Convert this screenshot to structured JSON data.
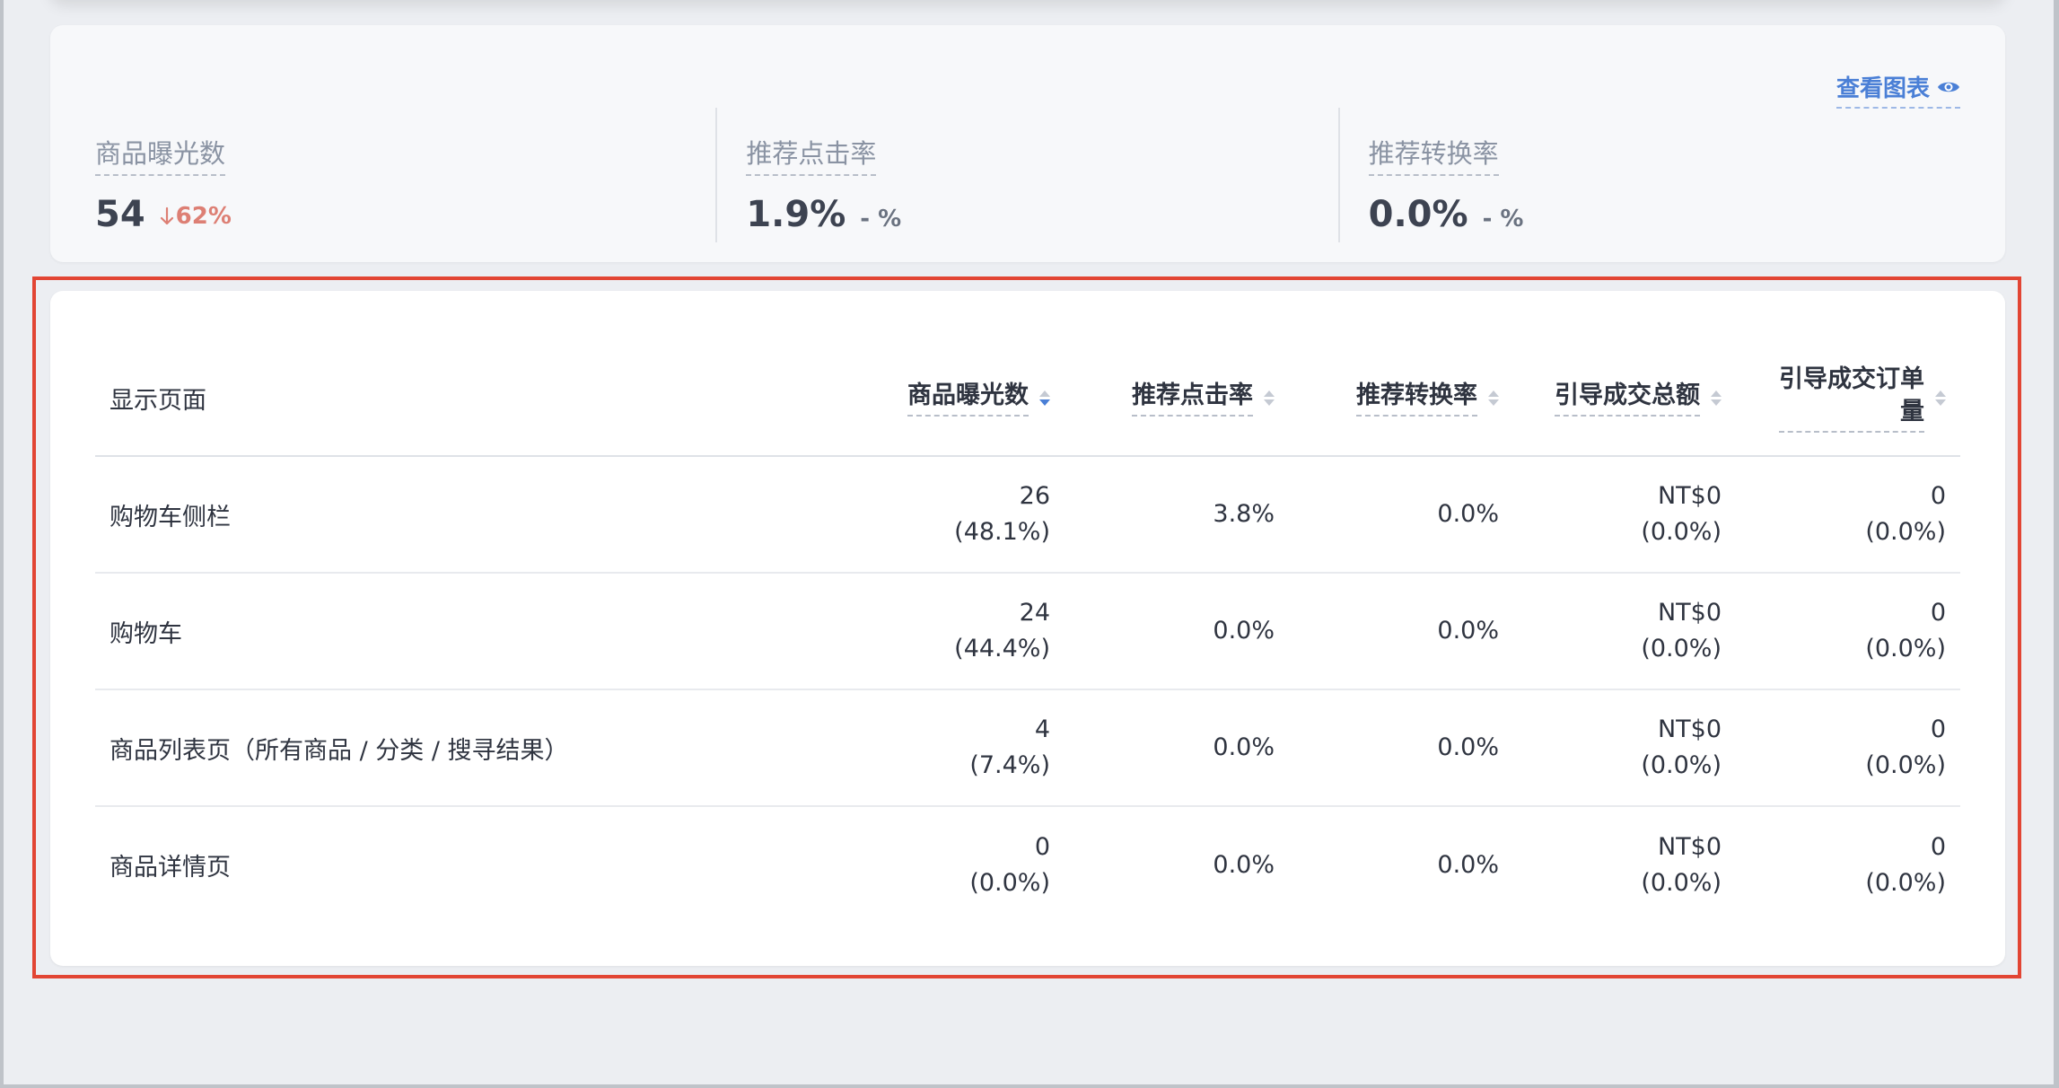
{
  "summary": {
    "view_chart_label": "查看图表",
    "metrics": [
      {
        "label": "商品曝光数",
        "value": "54",
        "change": "62%",
        "change_direction": "down"
      },
      {
        "label": "推荐点击率",
        "value": "1.9%",
        "change": "- %"
      },
      {
        "label": "推荐转换率",
        "value": "0.0%",
        "change": "- %"
      }
    ]
  },
  "table": {
    "headers": {
      "page": "显示页面",
      "impressions": "商品曝光数",
      "ctr": "推荐点击率",
      "cvr": "推荐转换率",
      "revenue": "引导成交总额",
      "orders_line1": "引导成交订单",
      "orders_line2": "量"
    },
    "rows": [
      {
        "page": "购物车侧栏",
        "impressions": "26",
        "impressions_pct": "(48.1%)",
        "ctr": "3.8%",
        "cvr": "0.0%",
        "revenue": "NT$0",
        "revenue_pct": "(0.0%)",
        "orders": "0",
        "orders_pct": "(0.0%)"
      },
      {
        "page": "购物车",
        "impressions": "24",
        "impressions_pct": "(44.4%)",
        "ctr": "0.0%",
        "cvr": "0.0%",
        "revenue": "NT$0",
        "revenue_pct": "(0.0%)",
        "orders": "0",
        "orders_pct": "(0.0%)"
      },
      {
        "page": "商品列表页（所有商品 / 分类 / 搜寻结果）",
        "impressions": "4",
        "impressions_pct": "(7.4%)",
        "ctr": "0.0%",
        "cvr": "0.0%",
        "revenue": "NT$0",
        "revenue_pct": "(0.0%)",
        "orders": "0",
        "orders_pct": "(0.0%)"
      },
      {
        "page": "商品详情页",
        "impressions": "0",
        "impressions_pct": "(0.0%)",
        "ctr": "0.0%",
        "cvr": "0.0%",
        "revenue": "NT$0",
        "revenue_pct": "(0.0%)",
        "orders": "0",
        "orders_pct": "(0.0%)"
      }
    ]
  },
  "colors": {
    "accent": "#4a7fd6",
    "down": "#dd7f74",
    "highlight": "#e24534"
  }
}
